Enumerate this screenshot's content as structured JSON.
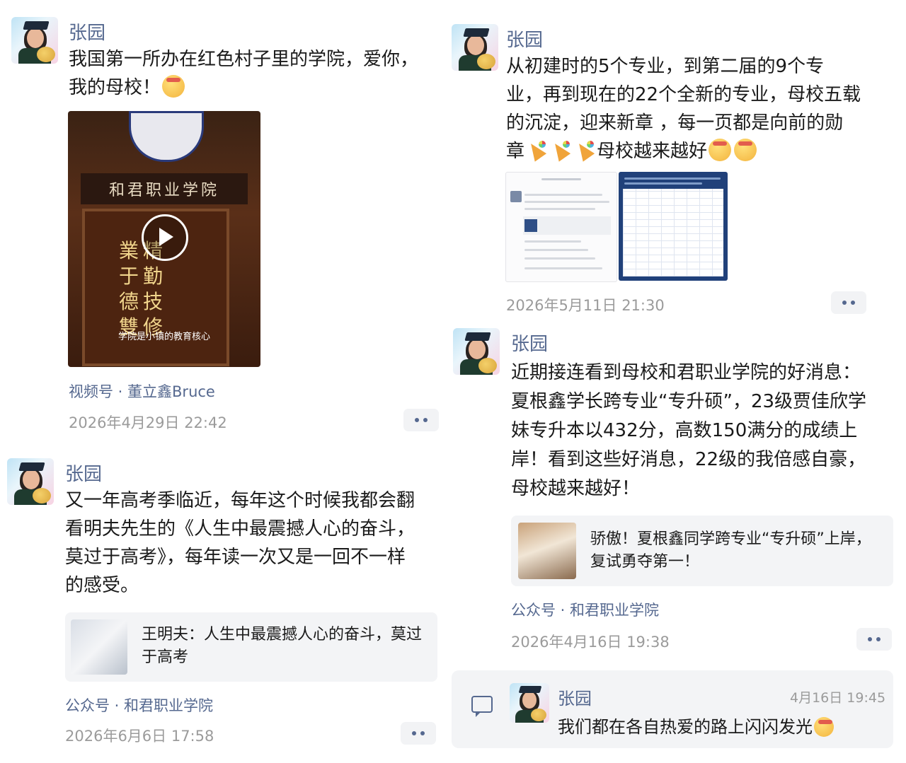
{
  "posts": [
    {
      "author": "张园",
      "text_parts": [
        "我国第一所办在红色村子里的学院，爱你，",
        "我的母校！"
      ],
      "video": {
        "sign": "和君职业学院",
        "calligraphy": "業精于勤 德技雙修",
        "caption": "学院是小镇的教育核心"
      },
      "source": "视频号 · 董立鑫Bruce",
      "time": "2026年4月29日 22:42"
    },
    {
      "author": "张园",
      "text_lines": [
        "又一年高考季临近，每年这个时候我都会翻",
        "看明夫先生的《人生中最震撼人心的奋斗，",
        "莫过于高考》，每年读一次又是一回不一样",
        "的感受。"
      ],
      "link": {
        "title_lines": [
          "王明夫：人生中最震撼人心的奋斗，莫过",
          "于高考"
        ]
      },
      "source": "公众号 · 和君职业学院",
      "time": "2026年6月6日 17:58"
    },
    {
      "author": "张园",
      "text_lines": [
        "从初建时的5个专业，到第二届的9个专",
        "业，再到现在的22个全新的专业，母校五载",
        "的沉淀，迎来新章 ，每一页都是向前的勋"
      ],
      "text_last_prefix": "章",
      "text_last_mid": "母校越来越好",
      "time": "2026年5月11日 21:30"
    },
    {
      "author": "张园",
      "text_lines": [
        "近期接连看到母校和君职业学院的好消息：",
        "夏根鑫学长跨专业“专升硕”，23级贾佳欣学",
        "妹专升本以432分，高数150满分的成绩上",
        "岸！看到这些好消息，22级的我倍感自豪，",
        "母校越来越好！"
      ],
      "link": {
        "title_lines": [
          "骄傲！夏根鑫同学跨专业“专升硕”上岸，",
          "复试勇夺第一！"
        ]
      },
      "source": "公众号 · 和君职业学院",
      "time": "2026年4月16日 19:38",
      "comment": {
        "author": "张园",
        "time": "4月16日 19:45",
        "text": "我们都在各自热爱的路上闪闪发光"
      }
    }
  ],
  "icons": [
    "avatar",
    "play-icon",
    "more-icon",
    "comment-icon",
    "party-emoji",
    "salute-emoji"
  ],
  "colors": {
    "name": "#55688f",
    "time": "#9b9b9b",
    "card_bg": "#f3f4f6"
  }
}
